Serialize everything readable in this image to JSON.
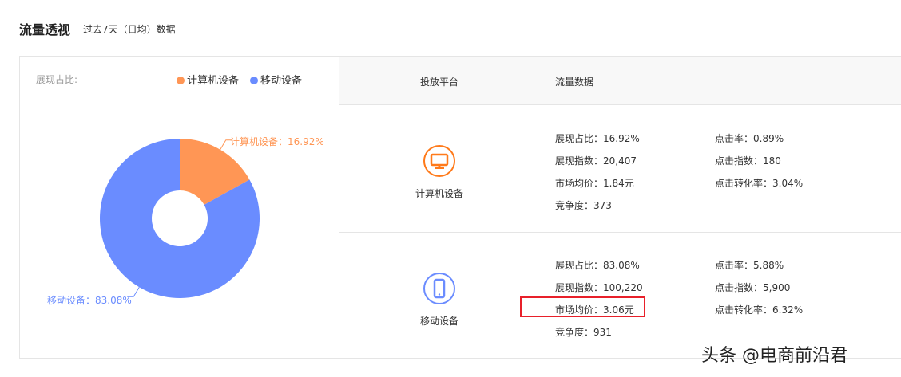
{
  "header": {
    "title": "流量透视",
    "subtitle": "过去7天（日均）数据"
  },
  "left": {
    "ratio_label": "展现占比:",
    "legend": [
      {
        "label": "计算机设备",
        "color": "#ff9655"
      },
      {
        "label": "移动设备",
        "color": "#6a8cff"
      }
    ]
  },
  "chart_data": {
    "type": "pie",
    "title": "展现占比",
    "slices": [
      {
        "name": "计算机设备",
        "value": 16.92,
        "label": "计算机设备：16.92%",
        "color": "#ff9655"
      },
      {
        "name": "移动设备",
        "value": 83.08,
        "label": "移动设备：83.08%",
        "color": "#6a8cff"
      }
    ]
  },
  "table": {
    "headers": [
      "投放平台",
      "流量数据"
    ],
    "rows": [
      {
        "platform": "计算机设备",
        "icon": "desktop-icon",
        "color": "#ff7a1a",
        "col1": [
          "展现占比：16.92%",
          "展现指数：20,407",
          "市场均价：1.84元",
          "竞争度：373"
        ],
        "col2": [
          "点击率：0.89%",
          "点击指数：180",
          "点击转化率：3.04%"
        ]
      },
      {
        "platform": "移动设备",
        "icon": "mobile-icon",
        "color": "#6b8cff",
        "col1": [
          "展现占比：83.08%",
          "展现指数：100,220",
          "市场均价：3.06元",
          "竞争度：931"
        ],
        "col2": [
          "点击率：5.88%",
          "点击指数：5,900",
          "点击转化率：6.32%"
        ]
      }
    ]
  },
  "watermark": "头条 @电商前沿君"
}
